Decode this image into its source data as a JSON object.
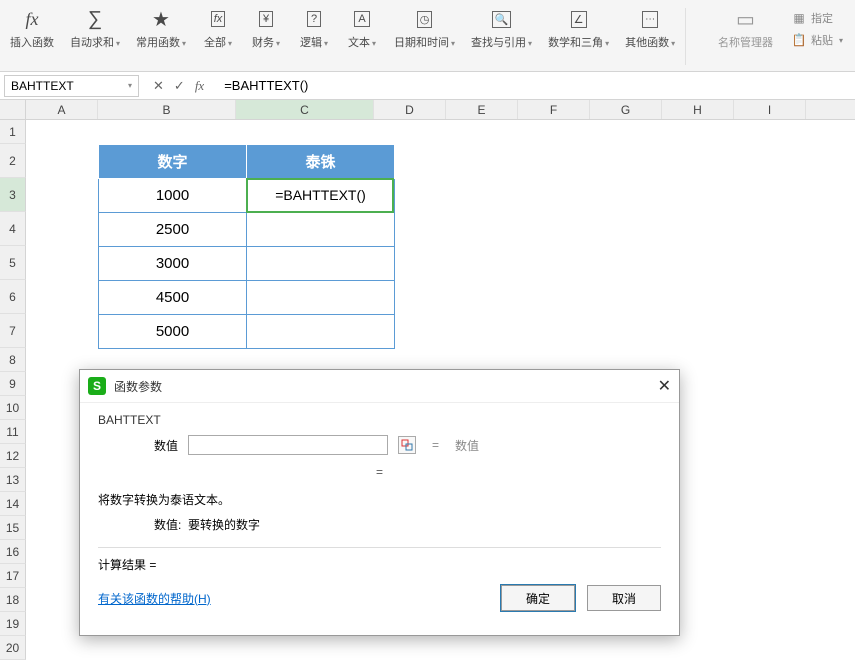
{
  "toolbar": {
    "insert_fn": "插入函数",
    "autosum": "自动求和",
    "common": "常用函数",
    "all": "全部",
    "finance": "财务",
    "logic": "逻辑",
    "text": "文本",
    "datetime": "日期和时间",
    "lookup": "查找与引用",
    "math": "数学和三角",
    "other": "其他函数",
    "name_mgr": "名称管理器",
    "paste": "粘贴",
    "assign": "指定"
  },
  "name_box": "BAHTTEXT",
  "formula": "=BAHTTEXT()",
  "columns": [
    "A",
    "B",
    "C",
    "D",
    "E",
    "F",
    "G",
    "H",
    "I"
  ],
  "table": {
    "h1": "数字",
    "h2": "泰铢",
    "rows": [
      "1000",
      "2500",
      "3000",
      "4500",
      "5000"
    ],
    "active_formula": "=BAHTTEXT()"
  },
  "dialog": {
    "title": "函数参数",
    "func": "BAHTTEXT",
    "param_label": "数值",
    "param_hint": "数值",
    "desc": "将数字转换为泰语文本。",
    "desc2_label": "数值:",
    "desc2_text": "要转换的数字",
    "result_label": "计算结果 =",
    "help": "有关该函数的帮助(H)",
    "ok": "确定",
    "cancel": "取消"
  }
}
